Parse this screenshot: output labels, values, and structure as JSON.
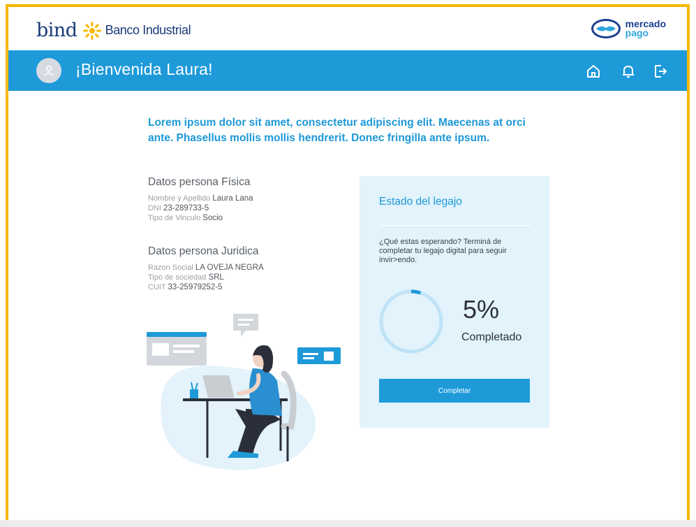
{
  "header": {
    "bank_brand": "bind",
    "bank_name": "Banco Industrial",
    "partner_line1": "mercado",
    "partner_line2": "pago"
  },
  "banner": {
    "welcome": "¡Bienvenida Laura!",
    "icons": [
      "home-icon",
      "bell-icon",
      "logout-icon"
    ]
  },
  "intro": "Lorem ipsum dolor sit amet, consectetur adipiscing elit. Maecenas at orci ante. Phasellus mollis mollis hendrerit. Donec fringilla ante ipsum.",
  "persona_fisica": {
    "title": "Datos persona Física",
    "fields": [
      {
        "label": "Nombre y Apellido",
        "value": "Laura Lana"
      },
      {
        "label": "DNI",
        "value": "23-289733-5"
      },
      {
        "label": "Tipo de Vinculo",
        "value": "Socio"
      }
    ]
  },
  "persona_juridica": {
    "title": "Datos persona Juridica",
    "fields": [
      {
        "label": "Razon Social",
        "value": "LA OVEJA NEGRA"
      },
      {
        "label": "Tipo de sociedad",
        "value": "SRL"
      },
      {
        "label": "CUIT",
        "value": "33-25979252-5"
      }
    ]
  },
  "status_card": {
    "title": "Estado del legajo",
    "message": "¿Qué estas esperando? Terminá de completar tu legajo digital para seguir invir>endo.",
    "progress_text": "5%",
    "progress_value": 0.05,
    "progress_label": "Completado",
    "button_label": "Completar"
  },
  "colors": {
    "accent": "#1e9ad9",
    "frame": "#f5b800",
    "card_bg": "#e2f3fc"
  }
}
